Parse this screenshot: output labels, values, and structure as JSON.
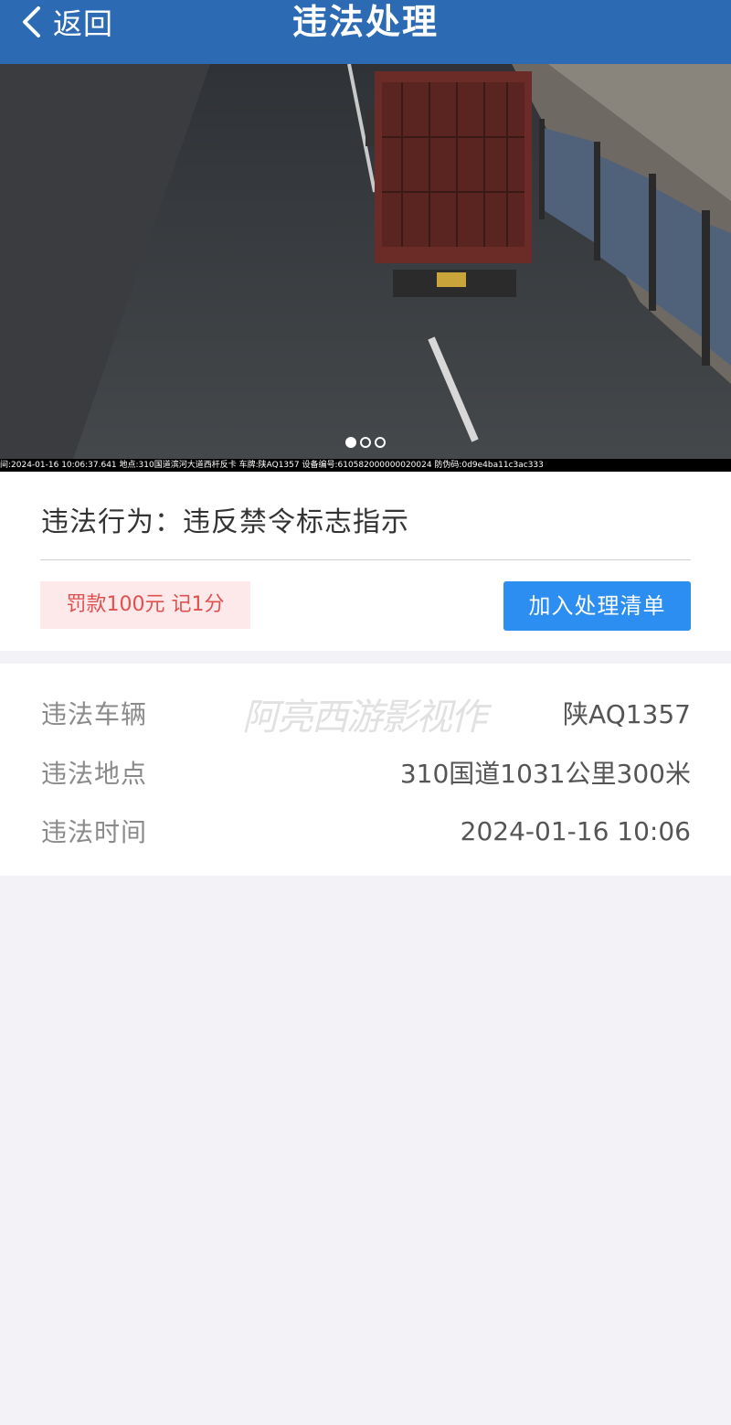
{
  "nav": {
    "back_label": "返回",
    "title": "违法处理"
  },
  "photo": {
    "caption": "间:2024-01-16 10:06:37.641 地点:310国道滨河大道西杆反卡 车牌:陕AQ1357 设备编号:610582000000020024 防伪码:0d9e4ba11c3ac333",
    "page_count": 3,
    "active_page": 1
  },
  "violation": {
    "behavior": "违法行为：违反禁令标志指示",
    "penalty": "罚款100元 记1分",
    "add_button": "加入处理清单"
  },
  "details": {
    "watermark": "阿亮西游影视作",
    "rows": [
      {
        "label": "违法车辆",
        "value": "陕AQ1357"
      },
      {
        "label": "违法地点",
        "value": "310国道1031公里300米"
      },
      {
        "label": "违法时间",
        "value": "2024-01-16 10:06"
      }
    ]
  },
  "colors": {
    "nav_bg": "#2d6ab4",
    "button_bg": "#2b8ef0",
    "penalty_bg": "#fde9e9",
    "penalty_text": "#e05050",
    "page_bg": "#f2f2f7"
  }
}
